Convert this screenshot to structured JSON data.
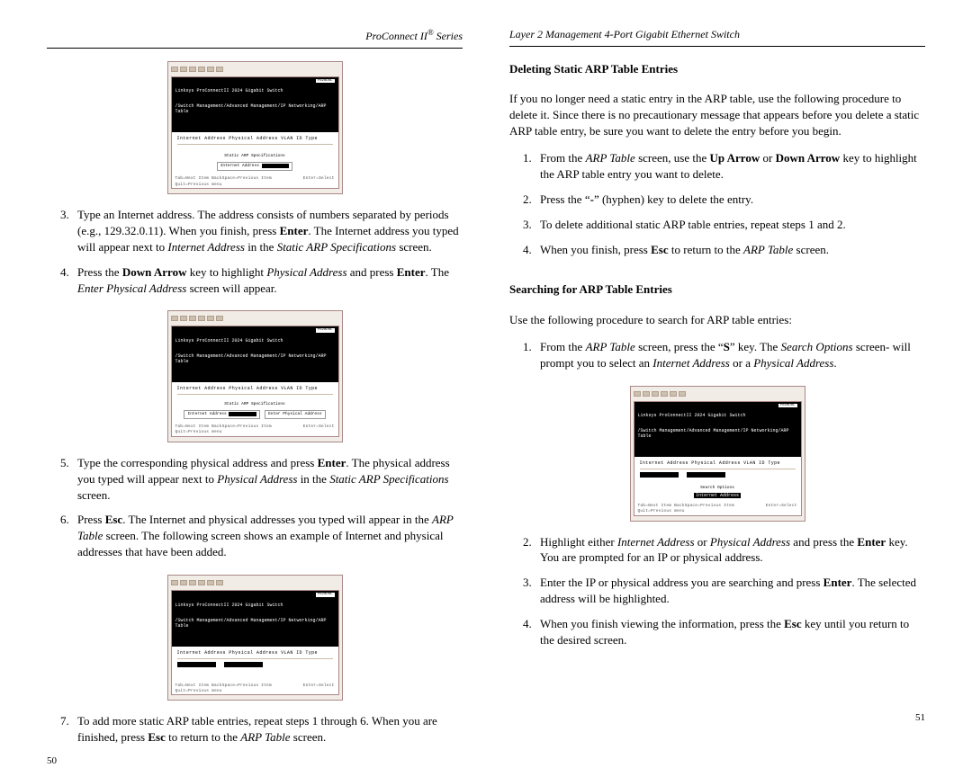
{
  "left": {
    "header_series_1": "ProConnect II",
    "header_series_2": " Series",
    "step3": {
      "t1": "Type an Internet address. The address consists of numbers separated by periods (e.g., 129.32.0.11). When you finish, press ",
      "enter": "Enter",
      "t2": ". The Internet address you typed will appear next to ",
      "ia": "Internet Address",
      "t3": " in the ",
      "sas": "Static ARP Specifications",
      "t4": " screen."
    },
    "step4": {
      "t1": "Press the ",
      "da": "Down Arrow",
      "t2": " key to highlight ",
      "pa": "Physical Address",
      "t3": " and press ",
      "enter1": "Enter",
      "t4": ". The ",
      "epa": "Enter Physical Address",
      "t5": " screen will appear."
    },
    "step5": {
      "t1": "Type the corresponding physical address and press ",
      "enter": "Enter",
      "t2": ". The physical address you typed will appear next to ",
      "pa": "Physical Address",
      "t3": " in the ",
      "sas": "Static ARP Specifications",
      "t4": " screen."
    },
    "step6": {
      "t1": "Press ",
      "esc": "Esc",
      "t2": ". The Internet and physical addresses you typed will appear in the ",
      "arp": "ARP Table",
      "t3": " screen. The following screen shows an example of Internet and physical addresses that have been added."
    },
    "step7": {
      "t1": "To add more static ARP table entries, repeat steps 1 through 6. When you are finished, press ",
      "esc": "Esc",
      "t2": " to return to the ",
      "arp": "ARP Table",
      "t3": " screen."
    },
    "page_num": "50"
  },
  "right": {
    "header": "Layer 2 Management 4-Port Gigabit Ethernet Switch",
    "h1": "Deleting Static ARP Table Entries",
    "p1": "If you no longer need a static entry in the ARP table, use the following procedure to delete it. Since there is no precautionary message that appears before you delete a static ARP table entry, be sure you want to delete the entry before you begin.",
    "d1": {
      "t1": "From the ",
      "arp": "ARP Table",
      "t2": " screen, use the ",
      "ua": "Up Arrow",
      "t3": " or ",
      "da": "Down Arrow",
      "t4": " key to highlight the ARP table entry you want to delete."
    },
    "d2": {
      "t1": "Press the “",
      "dash": "-",
      "t2": "” (hyphen) key to delete the entry."
    },
    "d3": "To delete additional static ARP table entries, repeat steps 1 and 2.",
    "d4": {
      "t1": "When you finish, press ",
      "esc": "Esc",
      "t2": " to return to the ",
      "arp": "ARP Table",
      "t3": " screen."
    },
    "h2": "Searching for ARP Table Entries",
    "p2": "Use the following procedure to search for ARP table entries:",
    "s1": {
      "t1": "From the ",
      "arp": "ARP Table",
      "t2": " screen, press the “",
      "skey": "S",
      "t3": "” key. The ",
      "so": "Search Options",
      "t4": " screen- will prompt you to select an ",
      "ia": "Internet Address",
      "t5": " or a ",
      "pa": "Physical Address",
      "t6": "."
    },
    "s2": {
      "t1": "Highlight either ",
      "ia": "Internet Address",
      "t2": " or ",
      "pa": "Physical Address",
      "t3": " and press the ",
      "enter": "Enter",
      "t4": " key. You are prompted for an IP or physical address."
    },
    "s3": {
      "t1": "Enter the IP or physical address you are searching and press ",
      "enter": "Enter",
      "t2": ". The selected address will be highlighted."
    },
    "s4": {
      "t1": "When you finish viewing the information, press the ",
      "esc": "Esc",
      "t2": " key until you return to the desired screen."
    },
    "page_num": "51"
  },
  "term": {
    "hdr1": "Linksys ProConnectII 2024 Gigabit Switch",
    "hdr2": "/Switch Management/Advanced Management/IP Networking/ARP Table",
    "badge": "P020DOL",
    "cols": "Internet Address   Physical Address    VLAN ID   Type",
    "sas_label": "Static ARP Specifications",
    "ia_label": "Internet Address",
    "pa_label": "Physical Address",
    "epa_label": "Enter Physical Address",
    "search_label": "Search Options",
    "ia_opt": "Internet Address",
    "foot_left": "Tab=Next Item BackSpace=Previous Item Quit=Previous menu",
    "foot_right": "Enter=Select"
  }
}
